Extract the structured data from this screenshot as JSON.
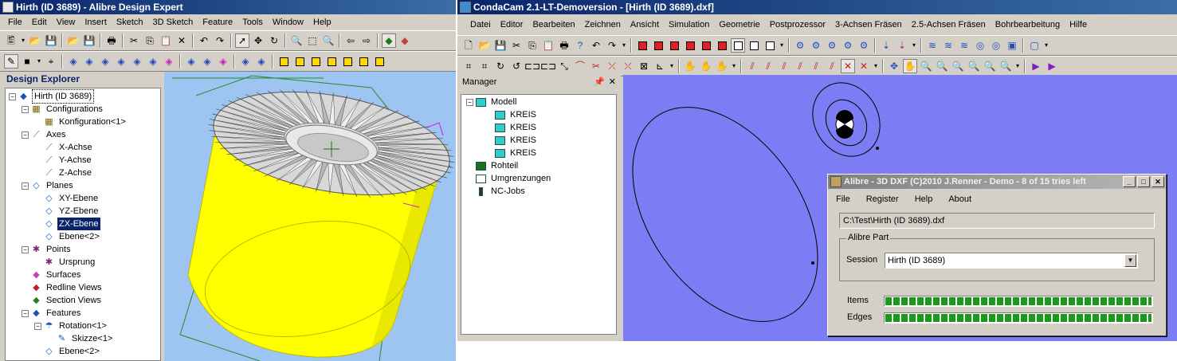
{
  "left_window": {
    "title": "Hirth (ID 3689) - Alibre Design Expert",
    "menu": [
      "File",
      "Edit",
      "View",
      "Insert",
      "Sketch",
      "3D Sketch",
      "Feature",
      "Tools",
      "Window",
      "Help"
    ],
    "explorer_title": "Design Explorer",
    "tree": [
      {
        "label": "Hirth (ID 3689)",
        "level": 0,
        "toggle": "−",
        "icon": "part-icon",
        "focus": true
      },
      {
        "label": "Configurations",
        "level": 1,
        "toggle": "−",
        "icon": "configurations-icon"
      },
      {
        "label": "Konfiguration<1>",
        "level": 2,
        "toggle": "",
        "icon": "configuration-icon"
      },
      {
        "label": "Axes",
        "level": 1,
        "toggle": "−",
        "icon": "axes-icon"
      },
      {
        "label": "X-Achse",
        "level": 2,
        "toggle": "",
        "icon": "axis-icon"
      },
      {
        "label": "Y-Achse",
        "level": 2,
        "toggle": "",
        "icon": "axis-icon"
      },
      {
        "label": "Z-Achse",
        "level": 2,
        "toggle": "",
        "icon": "axis-icon"
      },
      {
        "label": "Planes",
        "level": 1,
        "toggle": "−",
        "icon": "planes-icon"
      },
      {
        "label": "XY-Ebene",
        "level": 2,
        "toggle": "",
        "icon": "plane-icon"
      },
      {
        "label": "YZ-Ebene",
        "level": 2,
        "toggle": "",
        "icon": "plane-icon"
      },
      {
        "label": "ZX-Ebene",
        "level": 2,
        "toggle": "",
        "icon": "plane-icon",
        "selected": true
      },
      {
        "label": "Ebene<2>",
        "level": 2,
        "toggle": "",
        "icon": "plane-icon"
      },
      {
        "label": "Points",
        "level": 1,
        "toggle": "−",
        "icon": "points-icon"
      },
      {
        "label": "Ursprung",
        "level": 2,
        "toggle": "",
        "icon": "origin-icon"
      },
      {
        "label": "Surfaces",
        "level": 1,
        "toggle": "",
        "icon": "surfaces-icon"
      },
      {
        "label": "Redline Views",
        "level": 1,
        "toggle": "",
        "icon": "redline-views-icon"
      },
      {
        "label": "Section Views",
        "level": 1,
        "toggle": "",
        "icon": "section-views-icon"
      },
      {
        "label": "Features",
        "level": 1,
        "toggle": "−",
        "icon": "features-icon"
      },
      {
        "label": "Rotation<1>",
        "level": 2,
        "toggle": "−",
        "icon": "rotation-icon"
      },
      {
        "label": "Skizze<1>",
        "level": 3,
        "toggle": "",
        "icon": "sketch-icon"
      },
      {
        "label": "Ebene<2>",
        "level": 2,
        "toggle": "",
        "icon": "plane-icon"
      }
    ]
  },
  "right_window": {
    "title": "CondaCam 2.1-LT-Demoversion - [Hirth (ID 3689).dxf]",
    "menu": [
      "Datei",
      "Editor",
      "Bearbeiten",
      "Zeichnen",
      "Ansicht",
      "Simulation",
      "Geometrie",
      "Postprozessor",
      "3-Achsen Fräsen",
      "2.5-Achsen Fräsen",
      "Bohrbearbeitung",
      "Hilfe"
    ],
    "manager_title": "Manager",
    "tree": [
      {
        "label": "Modell",
        "level": 0,
        "toggle": "−",
        "icon": "model-icon",
        "color": "#33cccc"
      },
      {
        "label": "KREIS",
        "level": 1,
        "toggle": "",
        "icon": "kreis-icon",
        "color": "#33cccc"
      },
      {
        "label": "KREIS",
        "level": 1,
        "toggle": "",
        "icon": "kreis-icon",
        "color": "#33cccc"
      },
      {
        "label": "KREIS",
        "level": 1,
        "toggle": "",
        "icon": "kreis-icon",
        "color": "#33cccc"
      },
      {
        "label": "KREIS",
        "level": 1,
        "toggle": "",
        "icon": "kreis-icon",
        "color": "#33cccc"
      },
      {
        "label": "Rohteil",
        "level": 0,
        "toggle": "",
        "icon": "rohteil-icon",
        "color": "#1f6e1f"
      },
      {
        "label": "Umgrenzungen",
        "level": 0,
        "toggle": "",
        "icon": "umgrenzungen-icon",
        "color": "#ffffff"
      },
      {
        "label": "NC-Jobs",
        "level": 0,
        "toggle": "",
        "icon": "nc-jobs-icon",
        "color": "#333333"
      }
    ]
  },
  "dialog": {
    "title": "Alibre - 3D DXF (C)2010 J.Renner - Demo - 8 of 15 tries left",
    "menu": [
      "File",
      "Register",
      "Help",
      "About"
    ],
    "path": "C:\\Test\\Hirth (ID 3689).dxf",
    "group_label": "Alibre Part",
    "session_label": "Session",
    "session_value": "Hirth (ID 3689)",
    "items_label": "Items",
    "items_progress": 100,
    "edges_label": "Edges",
    "edges_progress": 100
  },
  "colors": {
    "titlebar_active": "#0a246a",
    "viewport_left_bg": "#9ec4f2",
    "viewport_right_bg": "#7c7cf4",
    "part_yellow": "#ffff00",
    "progress_green": "#1a9a1a",
    "selection": "#0a246a"
  }
}
